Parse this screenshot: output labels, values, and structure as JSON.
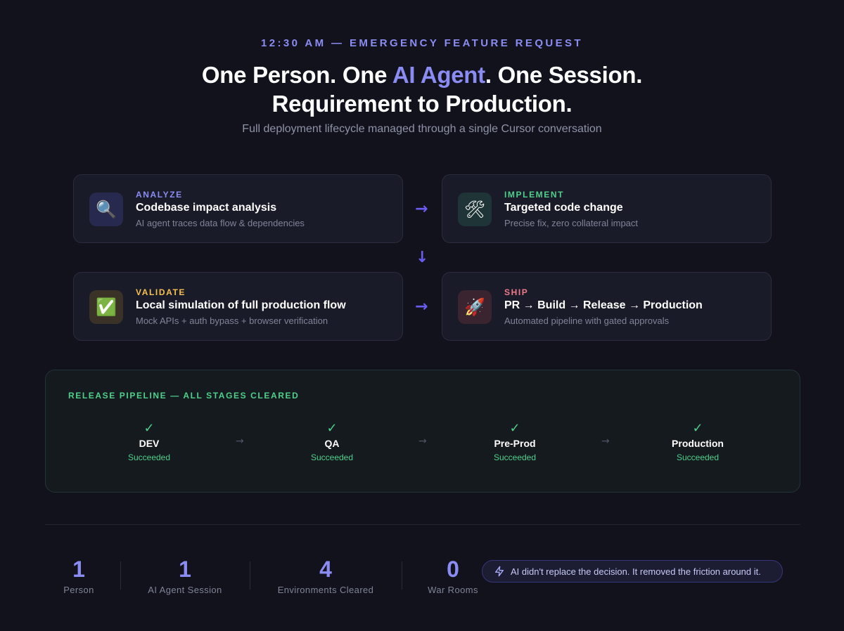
{
  "header": {
    "eyebrow": "12:30 AM — EMERGENCY FEATURE REQUEST",
    "headline_line1_part1": "One Person. One ",
    "headline_line1_accent": "AI Agent",
    "headline_line1_part2": ". One Session.",
    "headline_line2": "Requirement to Production.",
    "subtitle": "Full deployment lifecycle managed through a single Cursor conversation"
  },
  "cards": [
    {
      "tag": "ANALYZE",
      "title": "Codebase impact analysis",
      "desc": "AI agent traces data flow & dependencies",
      "icon": "magnifier-icon",
      "glyph": "🔍"
    },
    {
      "tag": "IMPLEMENT",
      "title": "Targeted code change",
      "desc": "Precise fix, zero collateral impact",
      "icon": "tools-icon",
      "glyph": "🛠"
    },
    {
      "tag": "VALIDATE",
      "title": "Local simulation of full production flow",
      "desc": "Mock APIs + auth bypass + browser verification",
      "icon": "check-mark-button-icon",
      "glyph": "✅"
    },
    {
      "tag": "SHIP",
      "title": "PR → Build → Release → Production",
      "desc": "Automated pipeline with gated approvals",
      "icon": "rocket-icon",
      "glyph": "🚀"
    }
  ],
  "colors": {
    "analyze": "#8b8cf3",
    "implement": "#4fd08a",
    "validate": "#f5c150",
    "ship": "#f07a8a",
    "accent": "#8b8cf3",
    "success": "#4fd08a"
  },
  "pipeline": {
    "title": "RELEASE PIPELINE — ALL STAGES CLEARED",
    "stages": [
      {
        "name": "DEV",
        "status": "Succeeded"
      },
      {
        "name": "QA",
        "status": "Succeeded"
      },
      {
        "name": "Pre-Prod",
        "status": "Succeeded"
      },
      {
        "name": "Production",
        "status": "Succeeded"
      }
    ]
  },
  "stats": [
    {
      "value": "1",
      "label": "Person"
    },
    {
      "value": "1",
      "label": "AI Agent Session"
    },
    {
      "value": "4",
      "label": "Environments Cleared"
    },
    {
      "value": "0",
      "label": "War Rooms"
    }
  ],
  "quote": "AI didn't replace the decision. It removed the friction around it."
}
